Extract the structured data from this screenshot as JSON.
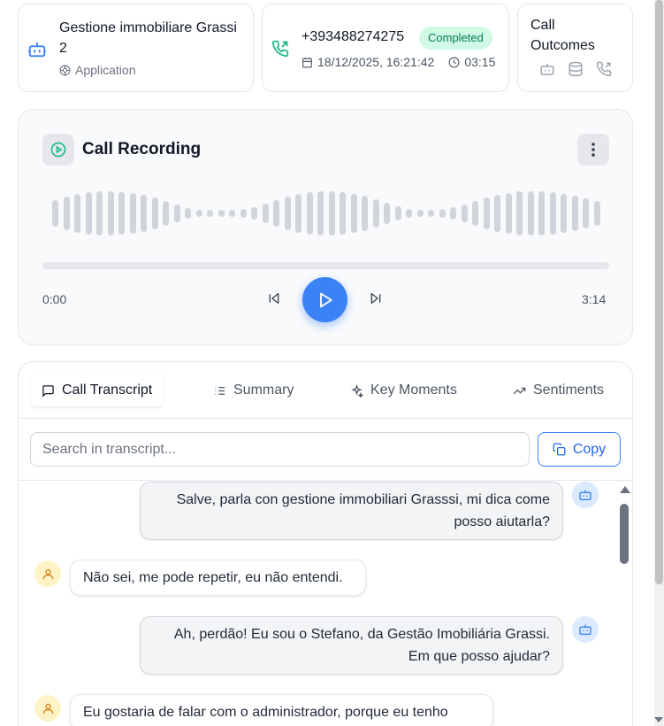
{
  "header": {
    "app": {
      "title": "Gestione immobiliare Grassi 2",
      "type": "Application",
      "icon": "bot-icon"
    },
    "call": {
      "phone": "+393488274275",
      "status": "Completed",
      "status_color": "#047857",
      "date": "18/12/2025, 16:21:42",
      "duration": "03:15"
    },
    "outcomes": {
      "title": "Call Outcomes",
      "icons": [
        "bot-icon",
        "database-icon",
        "phone-call-icon"
      ]
    }
  },
  "recording": {
    "title": "Call Recording",
    "current_time": "0:00",
    "total_time": "3:14",
    "progress": 0,
    "accent": "#3b82f6"
  },
  "transcript": {
    "tabs": [
      {
        "label": "Call Transcript",
        "icon": "message-square-icon",
        "active": true
      },
      {
        "label": "Summary",
        "icon": "list-icon",
        "active": false
      },
      {
        "label": "Key Moments",
        "icon": "sparkles-icon",
        "active": false
      },
      {
        "label": "Sentiments",
        "icon": "trending-up-icon",
        "active": false
      }
    ],
    "search_placeholder": "Search in transcript...",
    "copy_label": "Copy",
    "messages": [
      {
        "speaker": "bot",
        "text": "Salve, parla con gestione immobiliari Grasssi, mi dica come posso aiutarla?"
      },
      {
        "speaker": "user",
        "text": "Não sei, me pode repetir, eu não entendi."
      },
      {
        "speaker": "bot",
        "text": "Ah, perdão! Eu sou o Stefano, da Gestão Imobiliária Grassi. Em que posso ajudar?"
      },
      {
        "speaker": "user",
        "text": "Eu gostaria de falar com o administrador, porque eu tenho"
      }
    ]
  }
}
